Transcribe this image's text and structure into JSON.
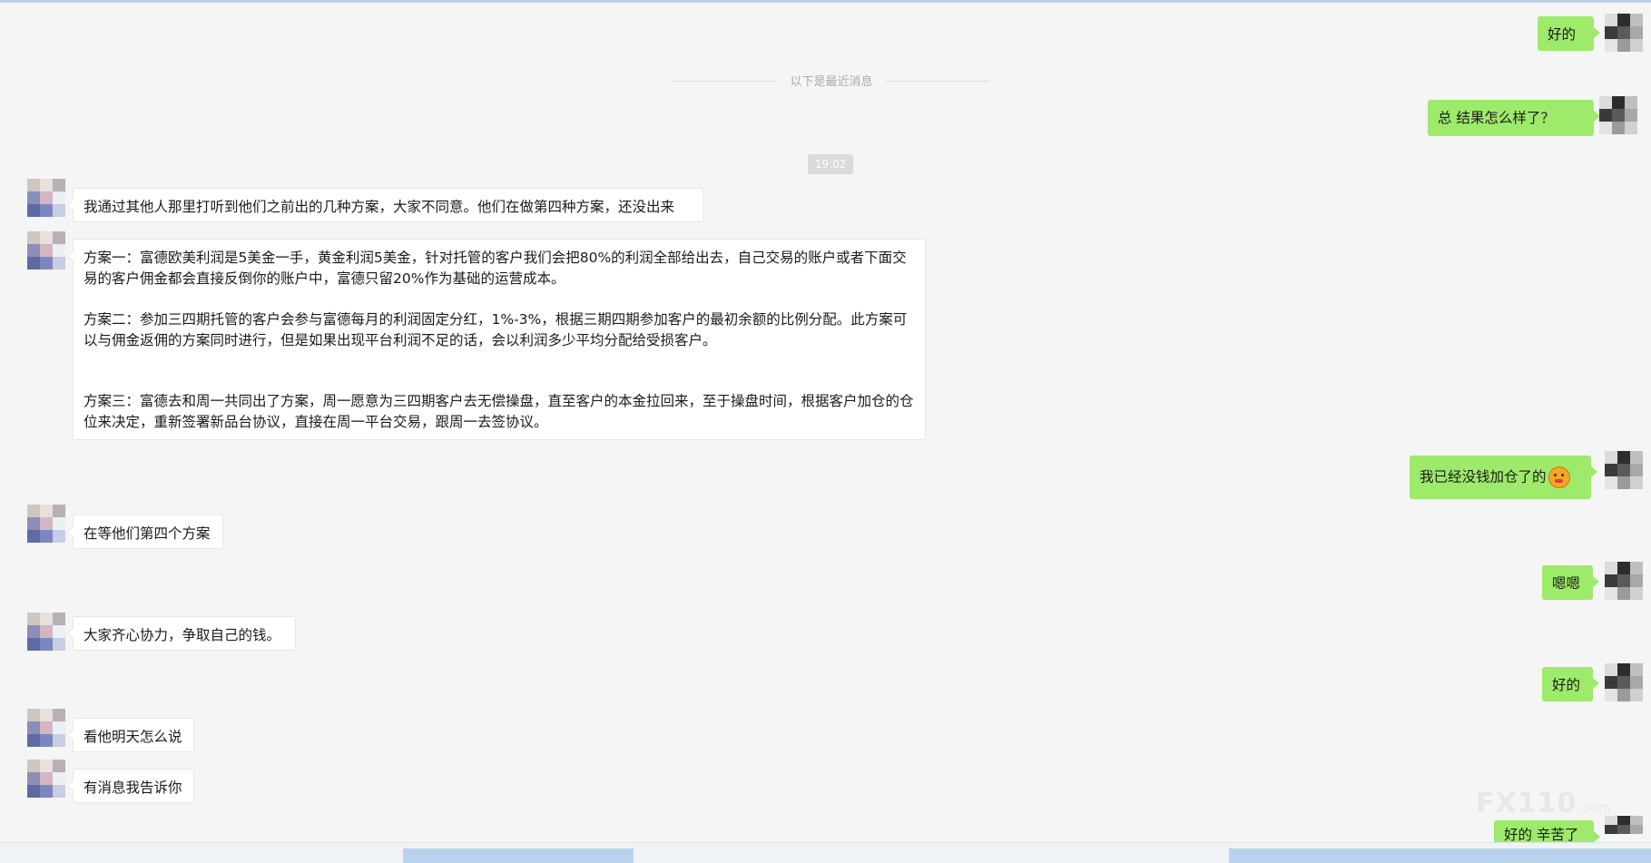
{
  "divider": {
    "text": "以下是最近消息"
  },
  "time_pill": "19:02",
  "messages": [
    {
      "side": "out",
      "text": "好的"
    },
    {
      "side": "out",
      "text": "总  结果怎么样了？"
    },
    {
      "side": "in",
      "text": "我通过其他人那里打听到他们之前出的几种方案，大家不同意。他们在做第四种方案，还没出来"
    },
    {
      "side": "in",
      "paragraphs": [
        "方案一：富德欧美利润是5美金一手，黄金利润5美金，针对托管的客户我们会把80%的利润全部给出去，自己交易的账户或者下面交易的客户佣金都会直接反倒你的账户中，富德只留20%作为基础的运营成本。",
        "方案二：参加三四期托管的客户会参与富德每月的利润固定分红，1%-3%，根据三期四期参加客户的最初余额的比例分配。此方案可以与佣金返佣的方案同时进行，但是如果出现平台利润不足的话，会以利润多少平均分配给受损客户。",
        "方案三：富德去和周一共同出了方案，周一愿意为三四期客户去无偿操盘，直至客户的本金拉回来，至于操盘时间，根据客户加仓的仓位来决定，重新签署新品台协议，直接在周一平台交易，跟周一去签协议。"
      ]
    },
    {
      "side": "out",
      "text": "我已经没钱加仓了的",
      "emoji": "angry-face-emoji"
    },
    {
      "side": "in",
      "text": "在等他们第四个方案"
    },
    {
      "side": "out",
      "text": "嗯嗯"
    },
    {
      "side": "in",
      "text": "大家齐心协力，争取自己的钱。"
    },
    {
      "side": "out",
      "text": "好的"
    },
    {
      "side": "in",
      "text": "看他明天怎么说"
    },
    {
      "side": "in",
      "text": "有消息我告诉你"
    },
    {
      "side": "out",
      "text": "好的 辛苦了"
    }
  ],
  "watermark": {
    "brand": "FX110",
    "suffix": ".com"
  },
  "colors": {
    "outgoing_bubble": "#9eea6a",
    "incoming_bubble": "#ffffff",
    "background": "#f5f5f5"
  }
}
